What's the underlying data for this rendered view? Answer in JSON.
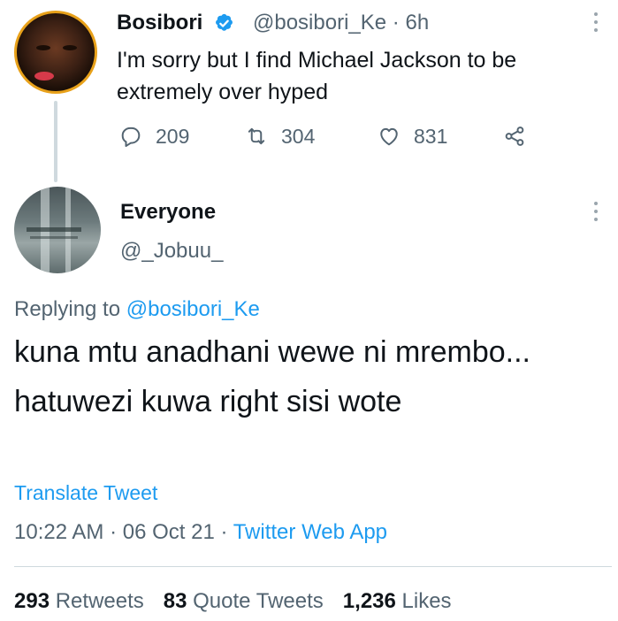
{
  "parent_tweet": {
    "display_name": "Bosibori",
    "handle": "@bosibori_Ke",
    "separator": "·",
    "time": "6h",
    "text": "I'm sorry but I find Michael Jackson to be extremely over hyped",
    "replies": "209",
    "retweets": "304",
    "likes": "831",
    "verified_color": "#1d9bf0"
  },
  "main_tweet": {
    "display_name": "Everyone",
    "handle": "@_Jobuu_",
    "replying_prefix": "Replying to ",
    "replying_to": "@bosibori_Ke",
    "text": "kuna mtu anadhani wewe ni mrembo... hatuwezi kuwa right sisi wote",
    "translate_label": "Translate Tweet",
    "time": "10:22 AM",
    "date": "06 Oct 21",
    "separator": "·",
    "source": "Twitter Web App",
    "stats": {
      "retweets_count": "293",
      "retweets_label": "Retweets",
      "quotes_count": "83",
      "quotes_label": "Quote Tweets",
      "likes_count": "1,236",
      "likes_label": "Likes"
    }
  },
  "colors": {
    "accent": "#1d9bf0",
    "secondary_text": "#536471",
    "primary_text": "#0f1419",
    "avatar_ring": "#e8a11a"
  }
}
